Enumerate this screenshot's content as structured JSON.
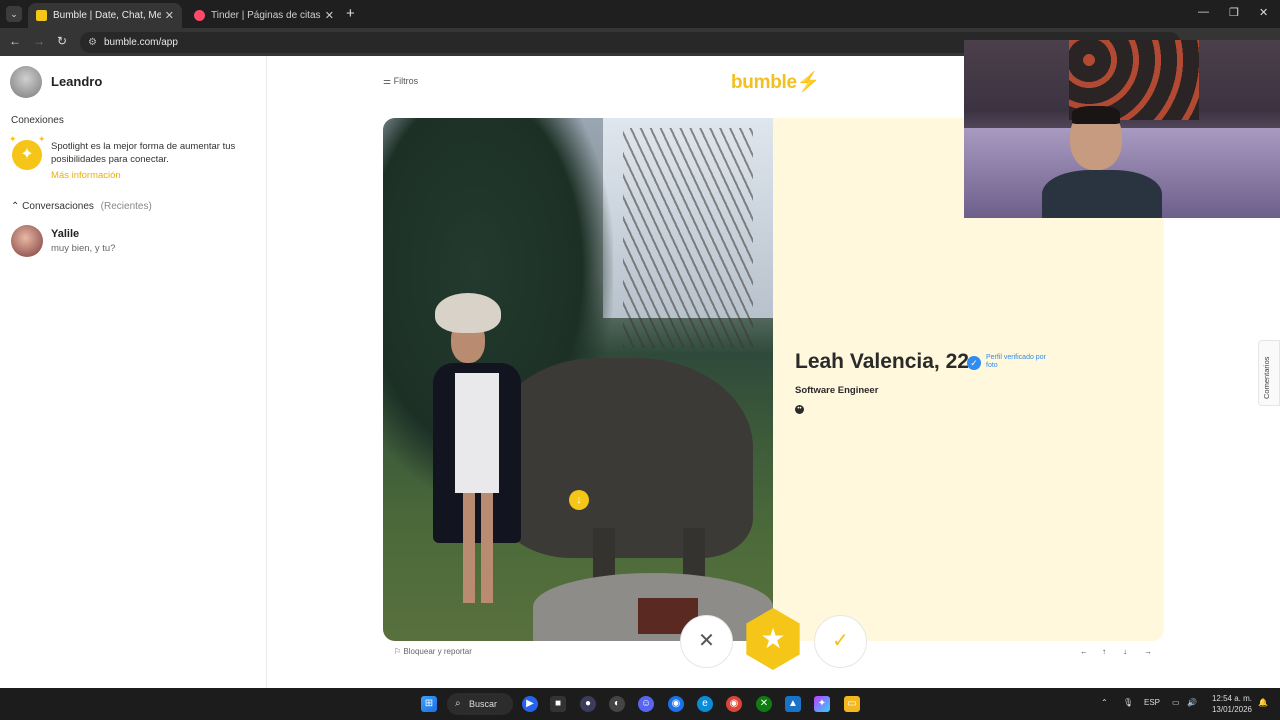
{
  "browser": {
    "tabs": [
      {
        "title": "Bumble | Date, Chat, Meet New",
        "favicon_color": "#f5c518"
      },
      {
        "title": "Tinder | Páginas de citas",
        "favicon_color": "#fd4a6a"
      }
    ],
    "url": "bumble.com/app"
  },
  "sidebar": {
    "user_name": "Leandro",
    "connections_label": "Conexiones",
    "spotlight_text": "Spotlight es la mejor forma de aumentar tus posibilidades para conectar.",
    "spotlight_link": "Más información",
    "conversations_label": "Conversaciones",
    "conversations_sub": "(Recientes)",
    "chats": [
      {
        "name": "Yalile",
        "last_message": "muy bien, y tu?"
      }
    ]
  },
  "header": {
    "filters_label": "Filtros",
    "logo_text": "bumble"
  },
  "profile": {
    "name_age": "Leah Valencia, 22",
    "verified_text": "Perfil verificado por foto",
    "job": "Software Engineer",
    "report_label": "Bloquear y reportar"
  },
  "actions": {
    "pass": "✕",
    "superswipe": "★",
    "like": "✓"
  },
  "keyboard_hints": [
    "←",
    "↑",
    "↓",
    "→"
  ],
  "feedback_label": "Comentarios",
  "taskbar": {
    "search_label": "Buscar",
    "language": "ESP",
    "time": "12:54 a. m.",
    "date": "13/01/2026"
  },
  "colors": {
    "brand": "#f5c518",
    "verified": "#2f8cf0",
    "info_panel": "#fff8dc"
  }
}
